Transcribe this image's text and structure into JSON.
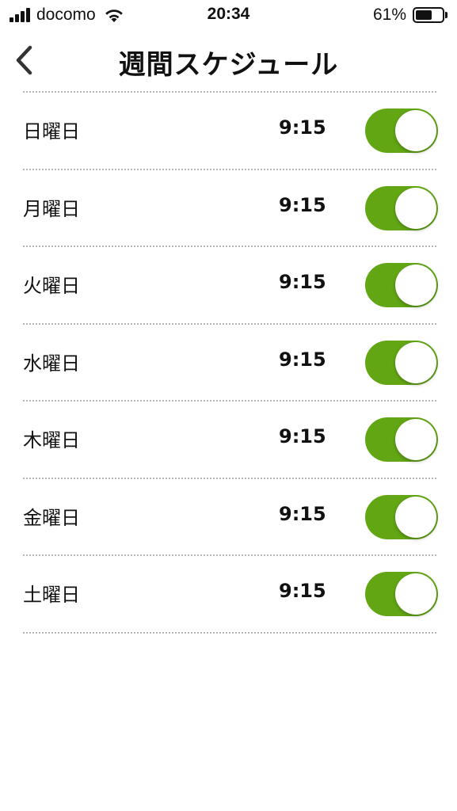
{
  "status_bar": {
    "carrier": "docomo",
    "time": "20:34",
    "battery_percent": "61%",
    "battery_level": 0.61
  },
  "header": {
    "title": "週間スケジュール",
    "back_icon": "chevron-left-icon"
  },
  "schedule": [
    {
      "day": "日曜日",
      "time": "9:15",
      "enabled": true
    },
    {
      "day": "月曜日",
      "time": "9:15",
      "enabled": true
    },
    {
      "day": "火曜日",
      "time": "9:15",
      "enabled": true
    },
    {
      "day": "水曜日",
      "time": "9:15",
      "enabled": true
    },
    {
      "day": "木曜日",
      "time": "9:15",
      "enabled": true
    },
    {
      "day": "金曜日",
      "time": "9:15",
      "enabled": true
    },
    {
      "day": "土曜日",
      "time": "9:15",
      "enabled": true
    }
  ],
  "colors": {
    "toggle_on": "#62a614",
    "divider": "#b5b5b5"
  }
}
